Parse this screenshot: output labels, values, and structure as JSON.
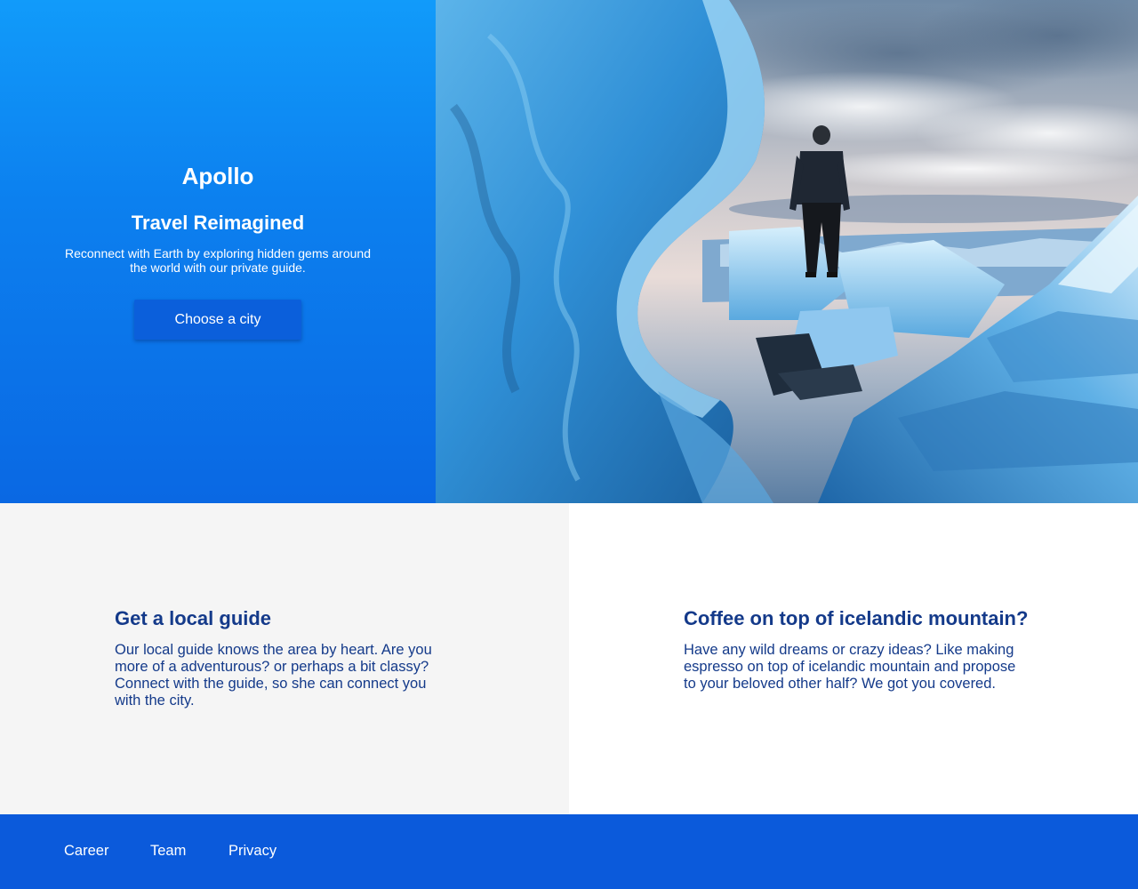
{
  "hero": {
    "brand": "Apollo",
    "title": "Travel Reimagined",
    "subtitle": "Reconnect with Earth by exploring hidden gems around the world with our private guide.",
    "cta_label": "Choose a city"
  },
  "features": [
    {
      "title": "Get a local guide",
      "text": "Our local guide knows the area by heart. Are you more of a adventurous? or perhaps a bit classy? Connect with the guide, so she can connect you with the city."
    },
    {
      "title": "Coffee on top of icelandic mountain?",
      "text": "Have any wild dreams or crazy ideas? Like making espresso on top of icelandic mountain and propose to your beloved other half? We got you covered."
    }
  ],
  "footer": {
    "links": [
      "Career",
      "Team",
      "Privacy"
    ]
  },
  "colors": {
    "hero_gradient_top": "#119bfa",
    "hero_gradient_bottom": "#0a68e3",
    "button": "#0b5fdb",
    "heading_text": "#143a8a",
    "feature_left_bg": "#f5f5f5",
    "footer_bg": "#0b5adb"
  }
}
